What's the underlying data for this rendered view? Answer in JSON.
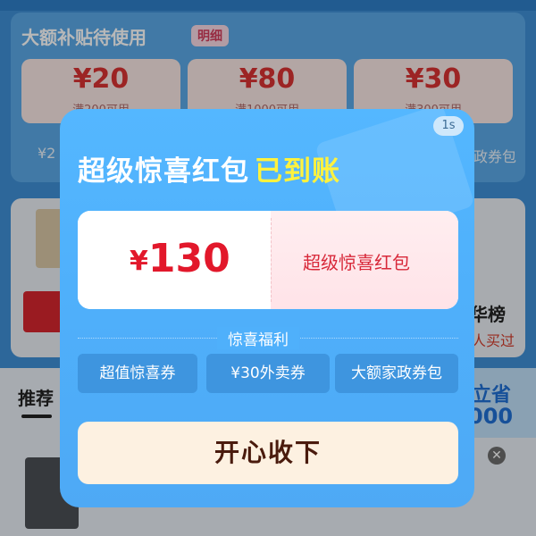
{
  "background": {
    "subsidy": {
      "title": "大额补贴待使用",
      "detail_tag": "明细",
      "coupons": [
        {
          "amount": "¥20",
          "condition": "满200可用"
        },
        {
          "amount": "¥80",
          "condition": "满1000可用"
        },
        {
          "amount": "¥30",
          "condition": "满300可用"
        }
      ],
      "row2_left": "¥2",
      "row2_right": "政券包"
    },
    "middle": {
      "right_title": "华榜",
      "right_sub": "人买过"
    },
    "recommend": {
      "title": "推荐",
      "promo_line1": "立省",
      "promo_line2": "000",
      "close_icon": "close-icon"
    }
  },
  "modal": {
    "timer": "1s",
    "title": "超级惊喜红包",
    "title_highlight": "已到账",
    "red_packet": {
      "currency": "¥",
      "amount": "130",
      "name": "超级惊喜红包"
    },
    "benefits_title": "惊喜福利",
    "benefits": [
      {
        "label": "超值惊喜券"
      },
      {
        "label": "¥30外卖券"
      },
      {
        "label": "大额家政券包"
      }
    ],
    "collect_button": "开心收下"
  },
  "colors": {
    "modal_bg": "#4fb0fb",
    "highlight": "#fff23d",
    "amount_red": "#e2182b",
    "collect_bg": "#fdf1e1"
  }
}
